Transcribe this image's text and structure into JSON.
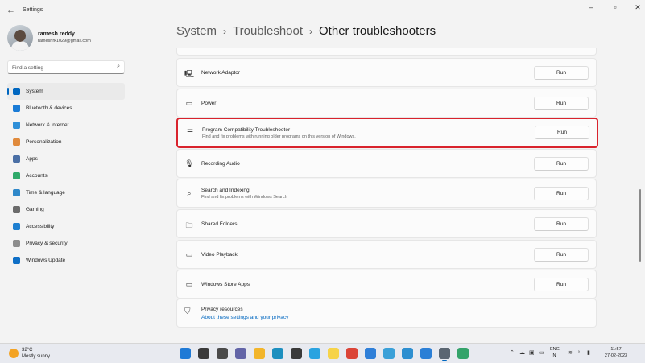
{
  "window": {
    "title": "Settings",
    "back_icon": "back-arrow-icon",
    "controls": [
      "minimize",
      "maximize",
      "close"
    ]
  },
  "profile": {
    "name": "ramesh reddy",
    "email": "rameshrk1029@gmail.com"
  },
  "search": {
    "placeholder": "Find a setting",
    "value": ""
  },
  "sidebar": {
    "items": [
      {
        "label": "System",
        "icon": "system-icon",
        "color": "#0067c0",
        "active": true
      },
      {
        "label": "Bluetooth & devices",
        "icon": "bluetooth-icon",
        "color": "#1a7bd6"
      },
      {
        "label": "Network & internet",
        "icon": "wifi-icon",
        "color": "#2e8fd8"
      },
      {
        "label": "Personalization",
        "icon": "brush-icon",
        "color": "#e08a3c"
      },
      {
        "label": "Apps",
        "icon": "apps-icon",
        "color": "#4a6fa5"
      },
      {
        "label": "Accounts",
        "icon": "person-icon",
        "color": "#2faa6a"
      },
      {
        "label": "Time & language",
        "icon": "globe-clock-icon",
        "color": "#2f88c9"
      },
      {
        "label": "Gaming",
        "icon": "controller-icon",
        "color": "#6b6b6b"
      },
      {
        "label": "Accessibility",
        "icon": "accessibility-icon",
        "color": "#1e7fd0"
      },
      {
        "label": "Privacy & security",
        "icon": "shield-icon",
        "color": "#8d8d8d"
      },
      {
        "label": "Windows Update",
        "icon": "update-icon",
        "color": "#0f6fc6"
      }
    ]
  },
  "breadcrumb": {
    "items": [
      "System",
      "Troubleshoot"
    ],
    "current": "Other troubleshooters"
  },
  "troubleshooters": [
    {
      "title": "Network Adaptor",
      "description": "",
      "icon": "monitor-icon",
      "glyph": "🖳",
      "button": "Run"
    },
    {
      "title": "Power",
      "description": "",
      "icon": "battery-icon",
      "glyph": "▭",
      "button": "Run"
    },
    {
      "title": "Program Compatibility Troubleshooter",
      "description": "Find and fix problems with running older programs on this version of Windows.",
      "icon": "list-icon",
      "glyph": "☰",
      "button": "Run",
      "highlighted": true
    },
    {
      "title": "Recording Audio",
      "description": "",
      "icon": "microphone-icon",
      "glyph": "🎙",
      "button": "Run"
    },
    {
      "title": "Search and Indexing",
      "description": "Find and fix problems with Windows Search",
      "icon": "search-icon",
      "glyph": "⌕",
      "button": "Run"
    },
    {
      "title": "Shared Folders",
      "description": "",
      "icon": "folder-icon",
      "glyph": "🗀",
      "button": "Run"
    },
    {
      "title": "Video Playback",
      "description": "",
      "icon": "video-icon",
      "glyph": "▭",
      "button": "Run"
    },
    {
      "title": "Windows Store Apps",
      "description": "",
      "icon": "store-icon",
      "glyph": "▭",
      "button": "Run"
    }
  ],
  "privacy": {
    "title": "Privacy resources",
    "link": "About these settings and your privacy",
    "icon": "shield-icon"
  },
  "taskbar": {
    "weather": {
      "temp": "32°C",
      "condition": "Mostly sunny",
      "icon": "sun-cloud-icon"
    },
    "apps": [
      {
        "name": "windows-start-icon",
        "color": "#1f7ad6"
      },
      {
        "name": "search-icon",
        "color": "#3a3a3a"
      },
      {
        "name": "task-view-icon",
        "color": "#4a4a4a"
      },
      {
        "name": "teams-chat-icon",
        "color": "#6264a7"
      },
      {
        "name": "file-explorer-icon",
        "color": "#f2b52b"
      },
      {
        "name": "edge-icon",
        "color": "#1c8fbf"
      },
      {
        "name": "slack-icon",
        "color": "#3a3a3a"
      },
      {
        "name": "telegram-icon",
        "color": "#2aa3e0"
      },
      {
        "name": "sticky-notes-icon",
        "color": "#f6d34a"
      },
      {
        "name": "chrome-icon",
        "color": "#db4437"
      },
      {
        "name": "todo-icon",
        "color": "#2f7fd8"
      },
      {
        "name": "photos-icon",
        "color": "#3aa0d8"
      },
      {
        "name": "gallery-icon",
        "color": "#2d8fd0"
      },
      {
        "name": "snipping-icon",
        "color": "#2b7fd6"
      },
      {
        "name": "settings-icon",
        "color": "#5b6672"
      },
      {
        "name": "spotify-like-icon",
        "color": "#34a36a"
      }
    ],
    "tray_icons": [
      "chevron-up-icon",
      "cloud-icon",
      "camera-icon",
      "battery-charge-icon"
    ],
    "lang": "ENG",
    "region": "IN",
    "time": "11:57",
    "date": "27-02-2023"
  }
}
